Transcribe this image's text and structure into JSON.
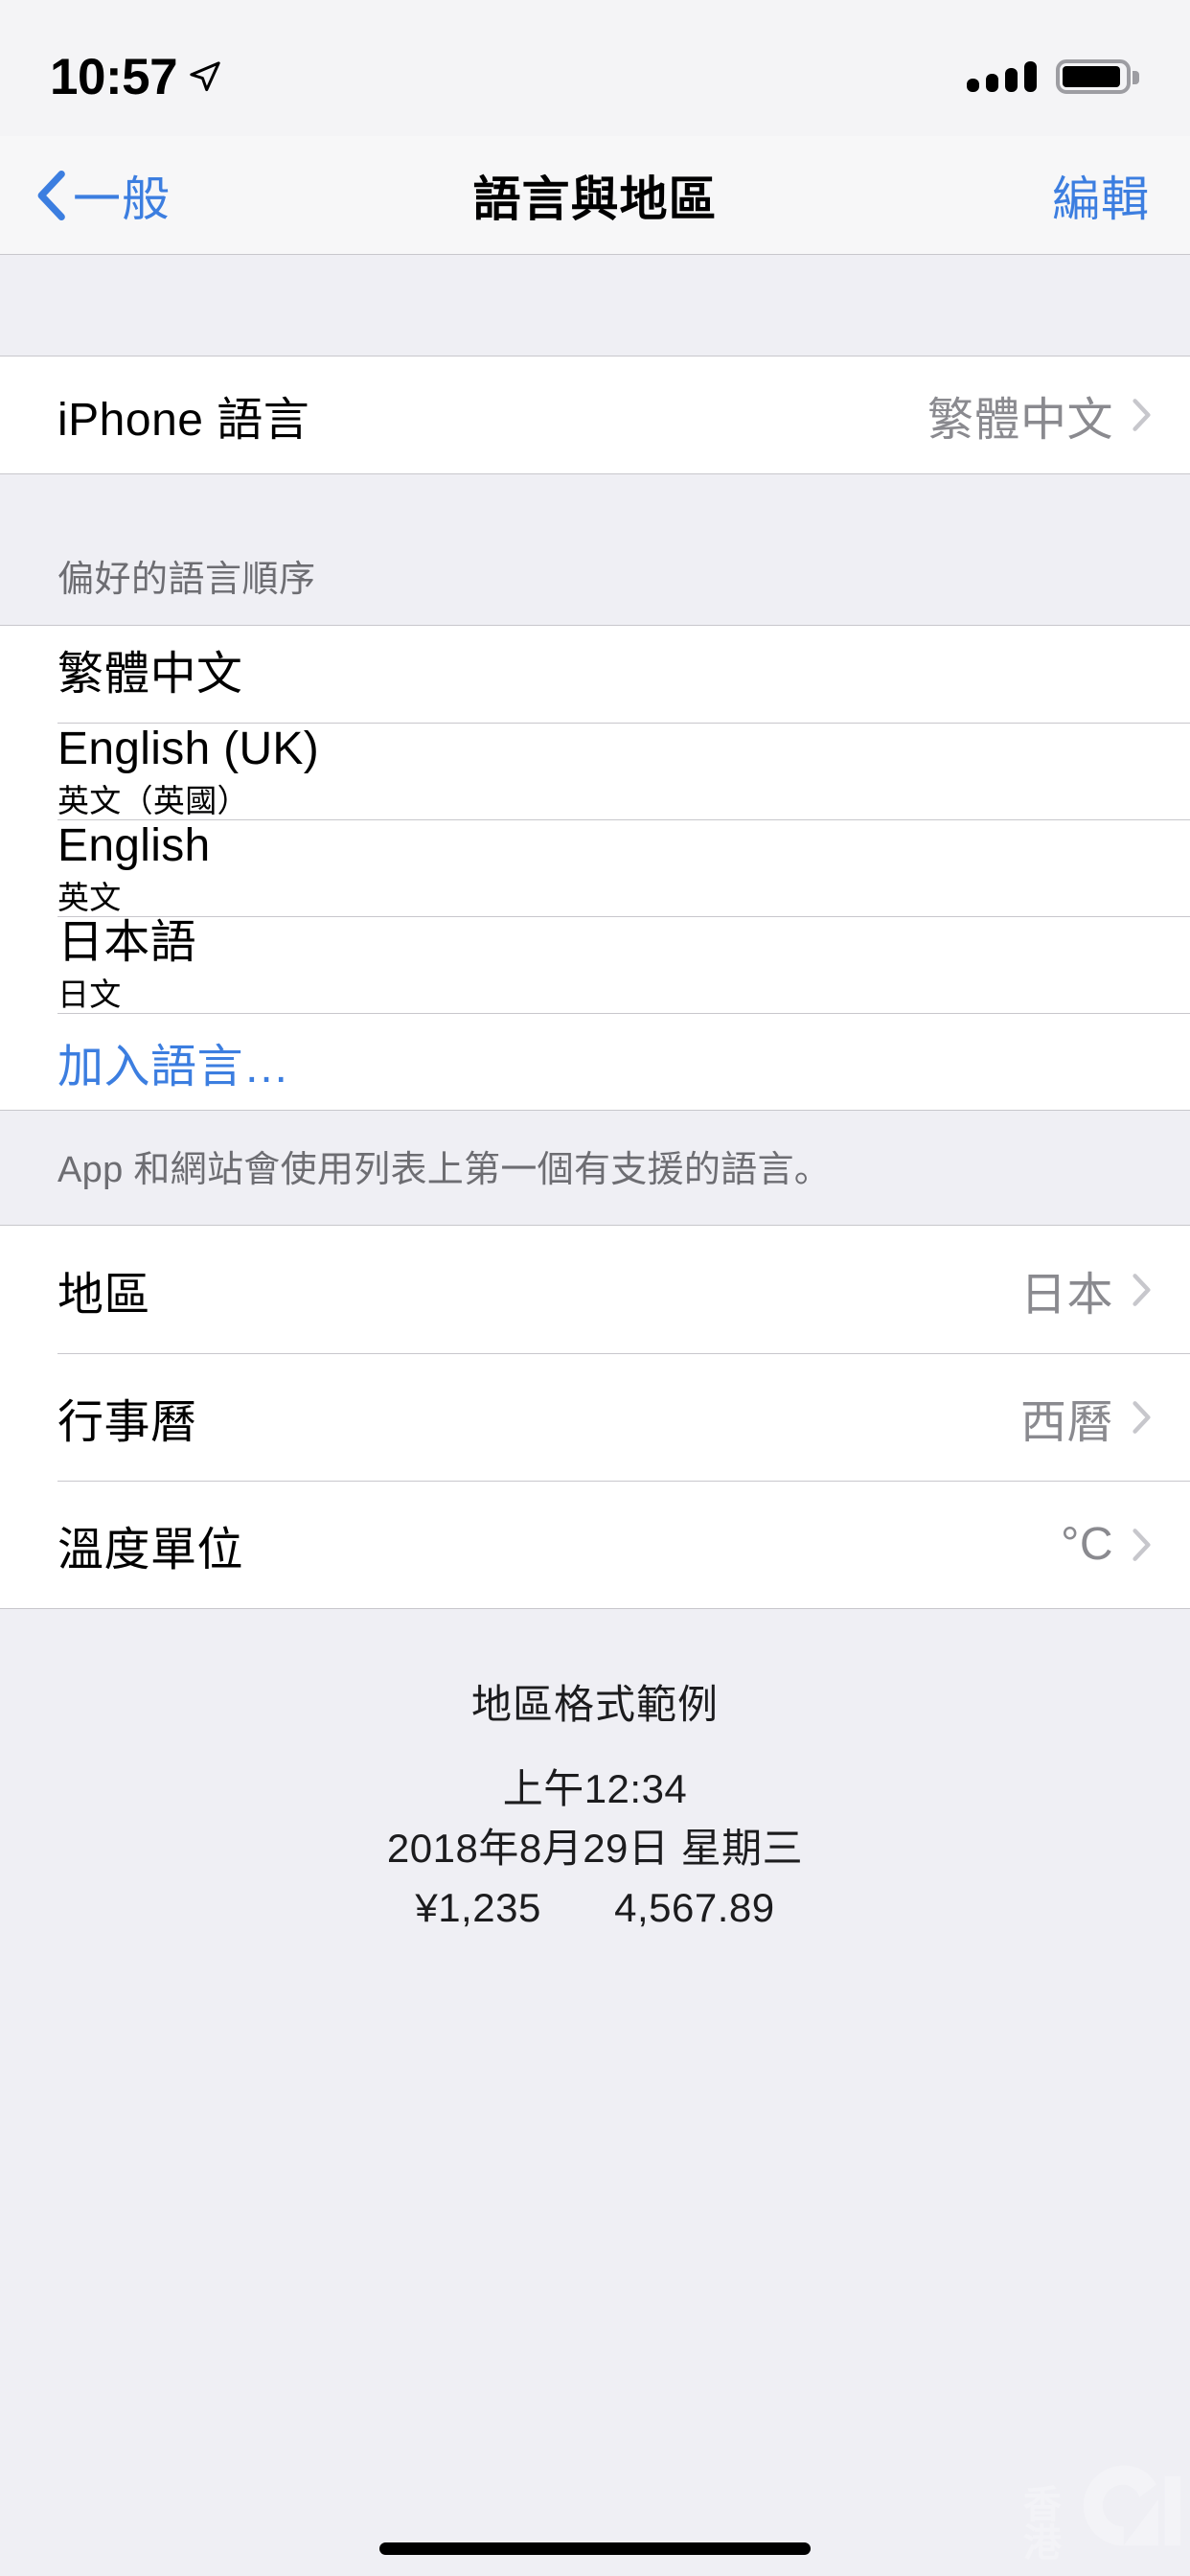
{
  "status_bar": {
    "time": "10:57",
    "location_icon": "location-arrow-icon",
    "signal_icon": "cellular-signal-icon",
    "battery_icon": "battery-full-icon"
  },
  "nav": {
    "back_label": "一般",
    "back_icon": "chevron-left-icon",
    "title": "語言與地區",
    "edit_label": "編輯"
  },
  "iphone_language": {
    "title": "iPhone 語言",
    "value": "繁體中文",
    "disclosure_icon": "chevron-right-icon"
  },
  "preferred_languages": {
    "header": "偏好的語言順序",
    "items": [
      {
        "name": "繁體中文",
        "sub": ""
      },
      {
        "name": "English (UK)",
        "sub": "英文（英國）"
      },
      {
        "name": "English",
        "sub": "英文"
      },
      {
        "name": "日本語",
        "sub": "日文"
      }
    ],
    "add_language_label": "加入語言…",
    "footer": "App 和網站會使用列表上第一個有支援的語言。"
  },
  "region_settings": {
    "rows": [
      {
        "title": "地區",
        "value": "日本"
      },
      {
        "title": "行事曆",
        "value": "西曆"
      },
      {
        "title": "溫度單位",
        "value": "°C"
      }
    ]
  },
  "region_format_example": {
    "title": "地區格式範例",
    "time": "上午12:34",
    "date": "2018年8月29日 星期三",
    "currency": "¥1,235",
    "number": "4,567.89"
  },
  "watermark": {
    "char1": "香",
    "char2": "港",
    "logo_icon": "hk01-logo-icon"
  },
  "colors": {
    "accent_blue": "#3C7EE0",
    "group_bg": "#FFFFFF",
    "page_bg": "#EFEFF4",
    "separator": "#C8C7CC",
    "secondary_text": "#8A8A8F"
  }
}
